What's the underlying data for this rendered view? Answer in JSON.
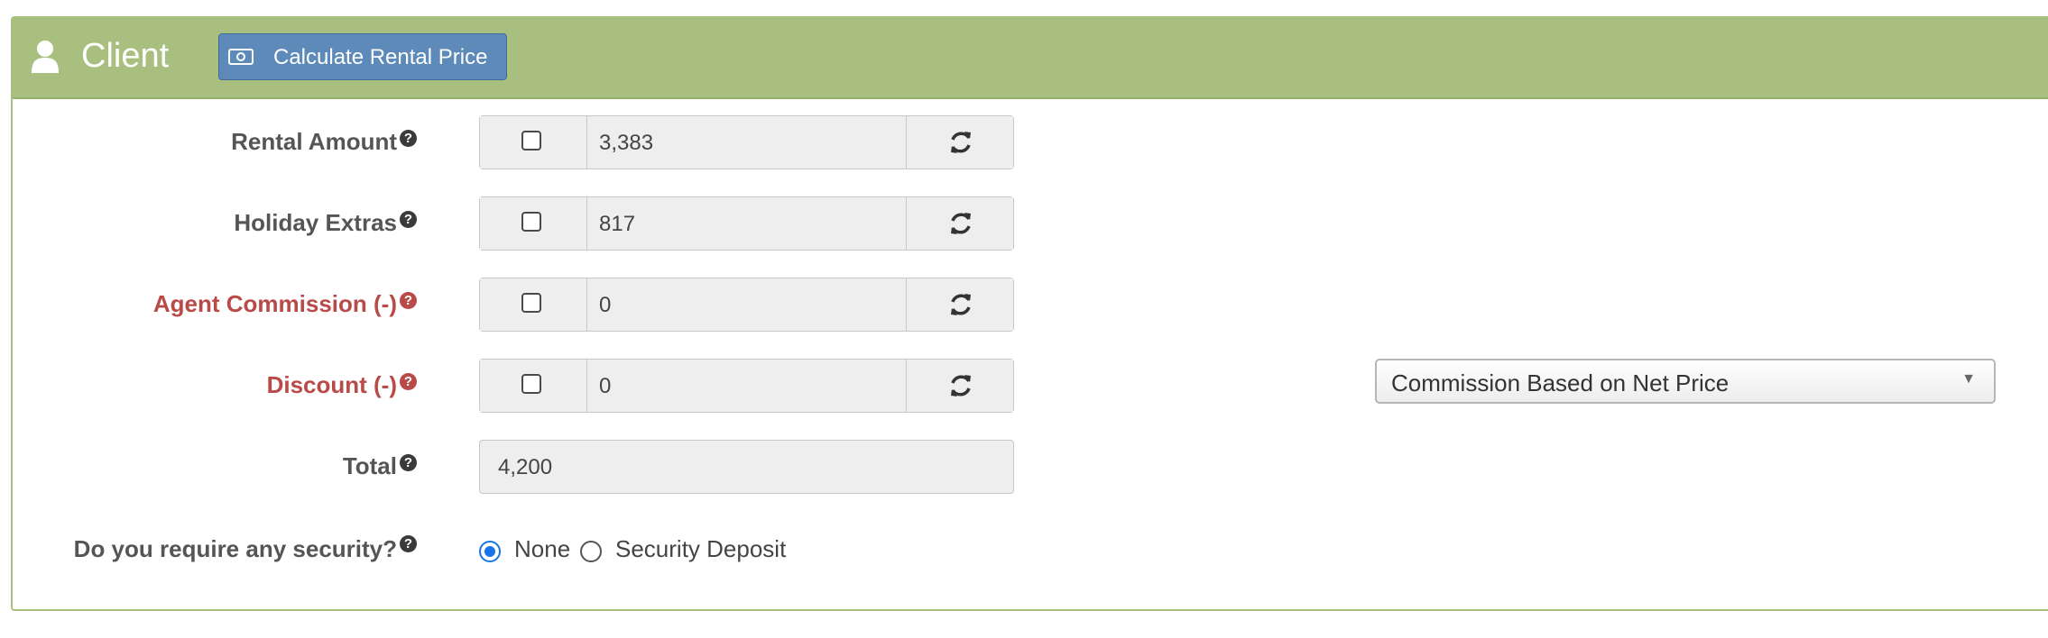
{
  "header": {
    "title": "Client",
    "calc_button_label": "Calculate Rental Price",
    "background_color": "#a9bf7f",
    "button_color": "#5d8ab8"
  },
  "rows": [
    {
      "label": "Rental Amount",
      "value": "3,383",
      "checked": false,
      "help_icon": "question-circle-icon",
      "color": "#555555"
    },
    {
      "label": "Holiday Extras",
      "value": "817",
      "checked": false,
      "help_icon": "question-circle-icon",
      "color": "#555555"
    },
    {
      "label": "Agent Commission (-)",
      "value": "0",
      "checked": false,
      "help_icon": "question-circle-icon",
      "color": "#b94a48"
    },
    {
      "label": "Discount (-)",
      "value": "0",
      "checked": false,
      "help_icon": "question-circle-icon",
      "color": "#b94a48"
    }
  ],
  "total": {
    "label": "Total",
    "value": "4,200"
  },
  "security": {
    "label": "Do you require any security?",
    "options": [
      "None",
      "Security Deposit"
    ],
    "selected": "None"
  },
  "commission_select": {
    "value": "Commission Based on Net Price"
  },
  "help_glyph": "?",
  "icons": {
    "user": "user-icon",
    "money": "money-icon",
    "refresh": "refresh-icon",
    "help": "question-circle-icon",
    "caret": "caret-down-icon"
  }
}
